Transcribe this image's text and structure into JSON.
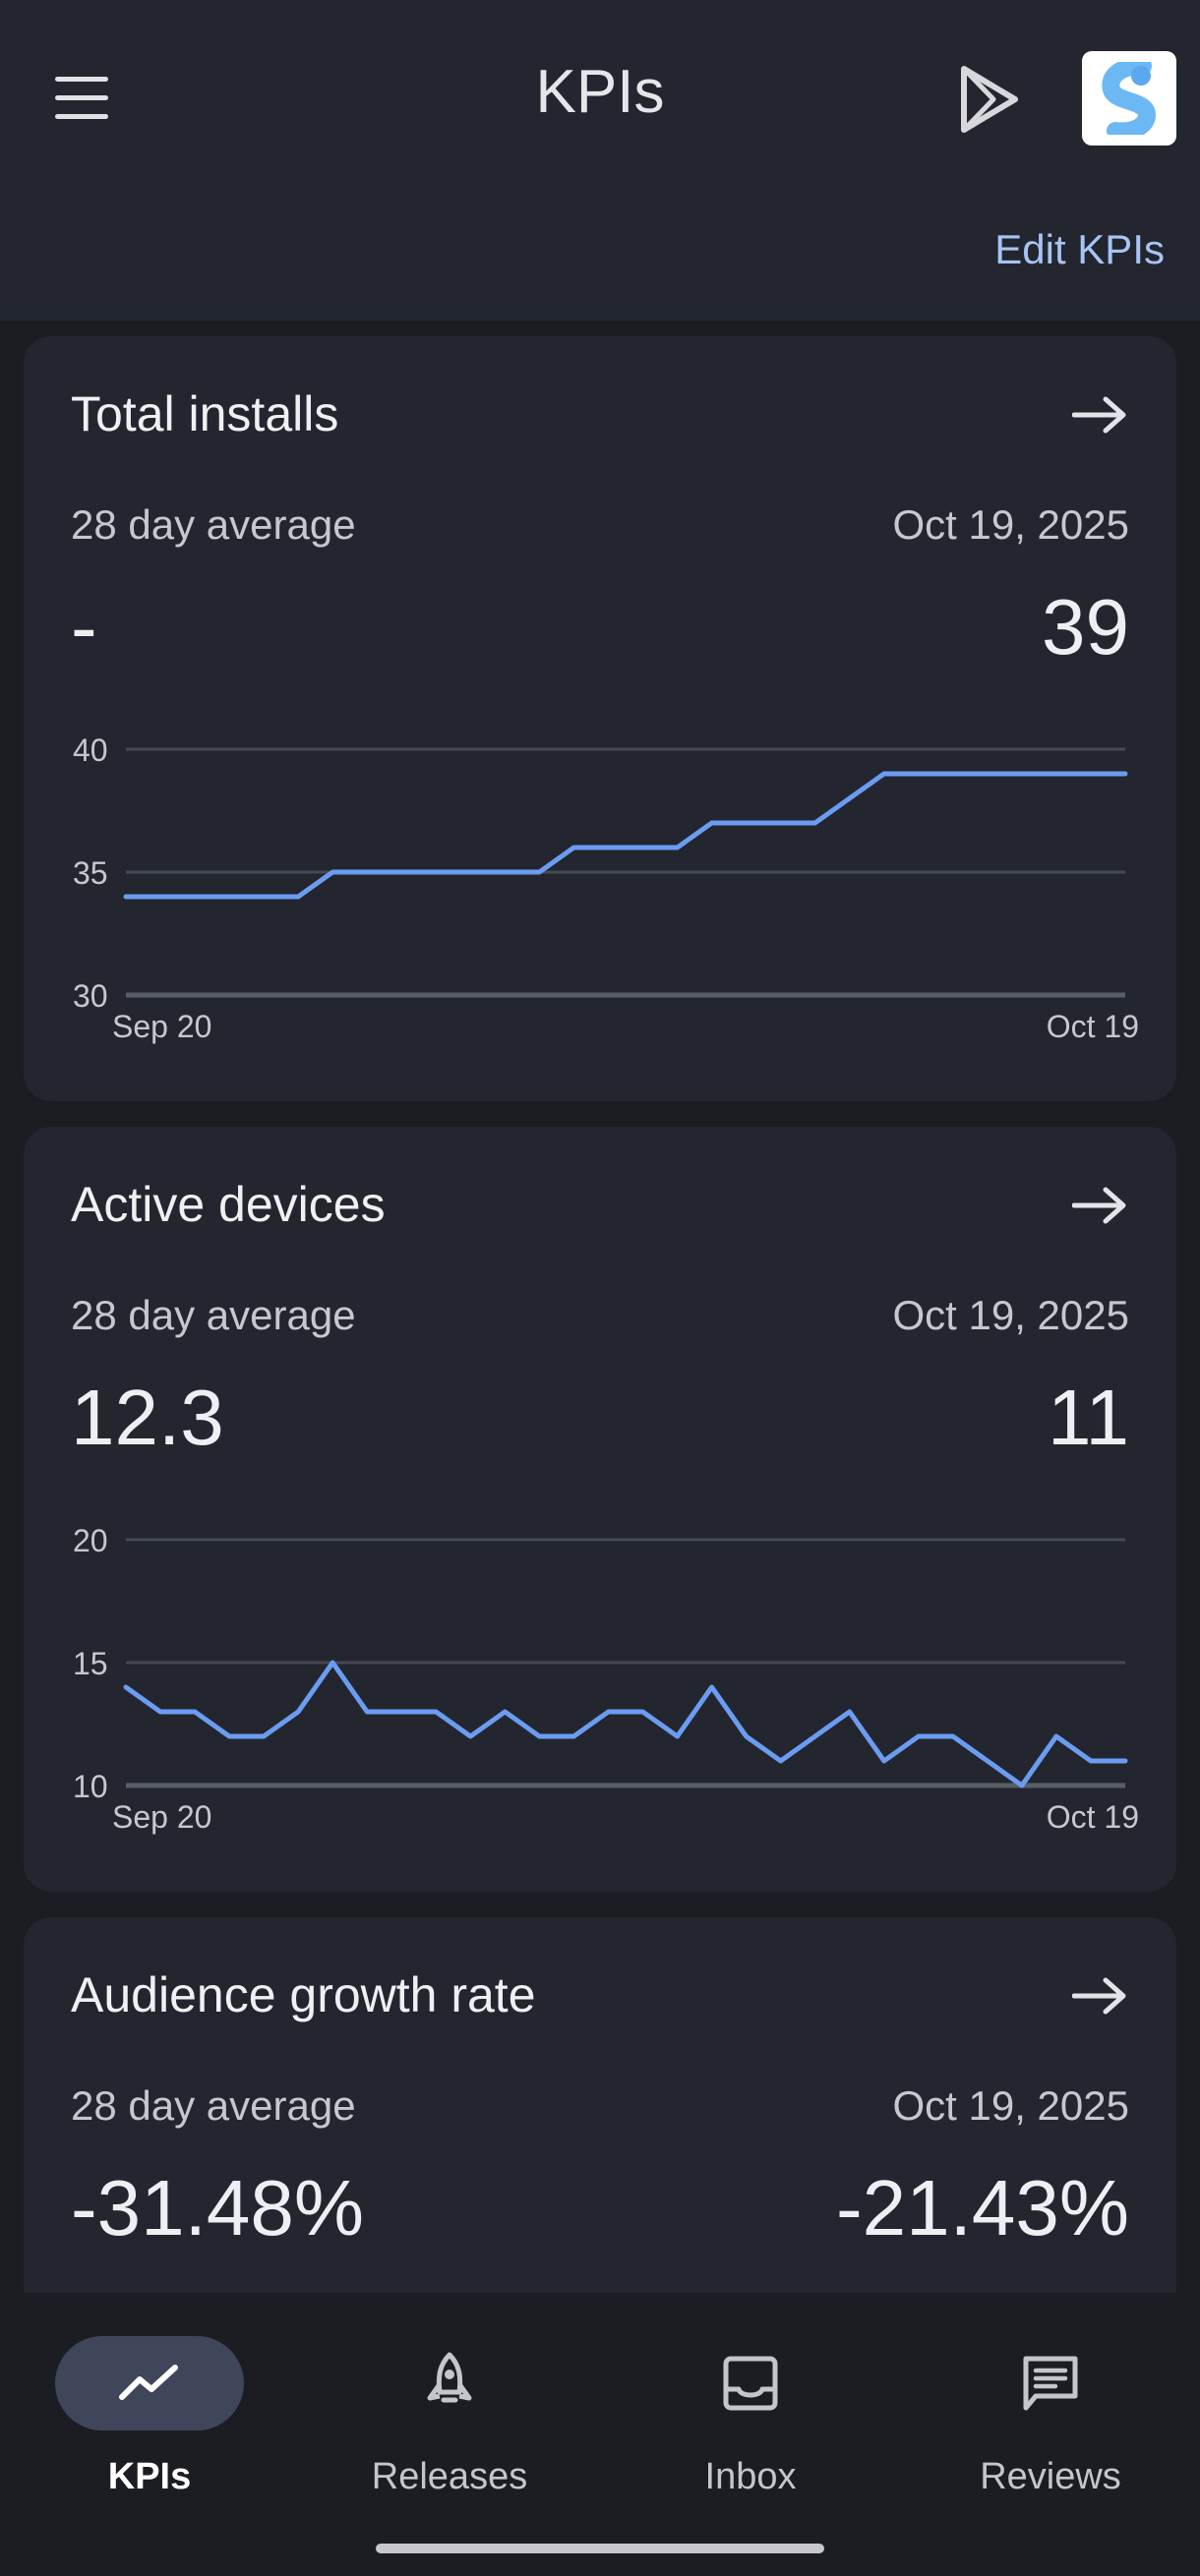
{
  "header": {
    "title": "KPIs",
    "edit_label": "Edit KPIs"
  },
  "cards": [
    {
      "title": "Total installs",
      "avg_label": "28 day average",
      "date_label": "Oct 19, 2025",
      "avg_value": "-",
      "current_value": "39"
    },
    {
      "title": "Active devices",
      "avg_label": "28 day average",
      "date_label": "Oct 19, 2025",
      "avg_value": "12.3",
      "current_value": "11"
    },
    {
      "title": "Audience growth rate",
      "avg_label": "28 day average",
      "date_label": "Oct 19, 2025",
      "avg_value": "-31.48%",
      "current_value": "-21.43%"
    }
  ],
  "nav": {
    "items": [
      {
        "label": "KPIs",
        "icon": "trending-icon",
        "active": true
      },
      {
        "label": "Releases",
        "icon": "rocket-icon",
        "active": false
      },
      {
        "label": "Inbox",
        "icon": "inbox-icon",
        "active": false
      },
      {
        "label": "Reviews",
        "icon": "reviews-icon",
        "active": false
      }
    ]
  },
  "colors": {
    "line": "#6b9cf2",
    "accent_link": "#a8c4f5",
    "card_bg": "#23262f",
    "page_bg": "#1b1d23"
  },
  "chart_data": [
    {
      "type": "line",
      "x": [
        "Sep 20",
        "Sep 21",
        "Sep 22",
        "Sep 23",
        "Sep 24",
        "Sep 25",
        "Sep 26",
        "Sep 27",
        "Sep 28",
        "Sep 29",
        "Sep 30",
        "Oct 1",
        "Oct 2",
        "Oct 3",
        "Oct 4",
        "Oct 5",
        "Oct 6",
        "Oct 7",
        "Oct 8",
        "Oct 9",
        "Oct 10",
        "Oct 11",
        "Oct 12",
        "Oct 13",
        "Oct 14",
        "Oct 15",
        "Oct 16",
        "Oct 17",
        "Oct 18",
        "Oct 19"
      ],
      "series": [
        {
          "values": [
            34,
            34,
            34,
            34,
            34,
            34,
            35,
            35,
            35,
            35,
            35,
            35,
            35,
            36,
            36,
            36,
            36,
            37,
            37,
            37,
            37,
            38,
            39,
            39,
            39,
            39,
            39,
            39,
            39,
            39
          ]
        }
      ],
      "xticks": [
        "Sep 20",
        "Oct 19"
      ],
      "yticks": [
        "30",
        "35",
        "40"
      ],
      "ylim": [
        30,
        40
      ],
      "grid": true
    },
    {
      "type": "line",
      "x": [
        "Sep 20",
        "Sep 21",
        "Sep 22",
        "Sep 23",
        "Sep 24",
        "Sep 25",
        "Sep 26",
        "Sep 27",
        "Sep 28",
        "Sep 29",
        "Sep 30",
        "Oct 1",
        "Oct 2",
        "Oct 3",
        "Oct 4",
        "Oct 5",
        "Oct 6",
        "Oct 7",
        "Oct 8",
        "Oct 9",
        "Oct 10",
        "Oct 11",
        "Oct 12",
        "Oct 13",
        "Oct 14",
        "Oct 15",
        "Oct 16",
        "Oct 17",
        "Oct 18",
        "Oct 19"
      ],
      "series": [
        {
          "values": [
            14,
            13,
            13,
            12,
            12,
            13,
            15,
            13,
            13,
            13,
            12,
            13,
            12,
            12,
            13,
            13,
            12,
            14,
            12,
            11,
            12,
            13,
            11,
            12,
            12,
            11,
            10,
            12,
            11,
            11
          ]
        }
      ],
      "xticks": [
        "Sep 20",
        "Oct 19"
      ],
      "yticks": [
        "10",
        "15",
        "20"
      ],
      "ylim": [
        10,
        20
      ],
      "grid": true
    }
  ]
}
